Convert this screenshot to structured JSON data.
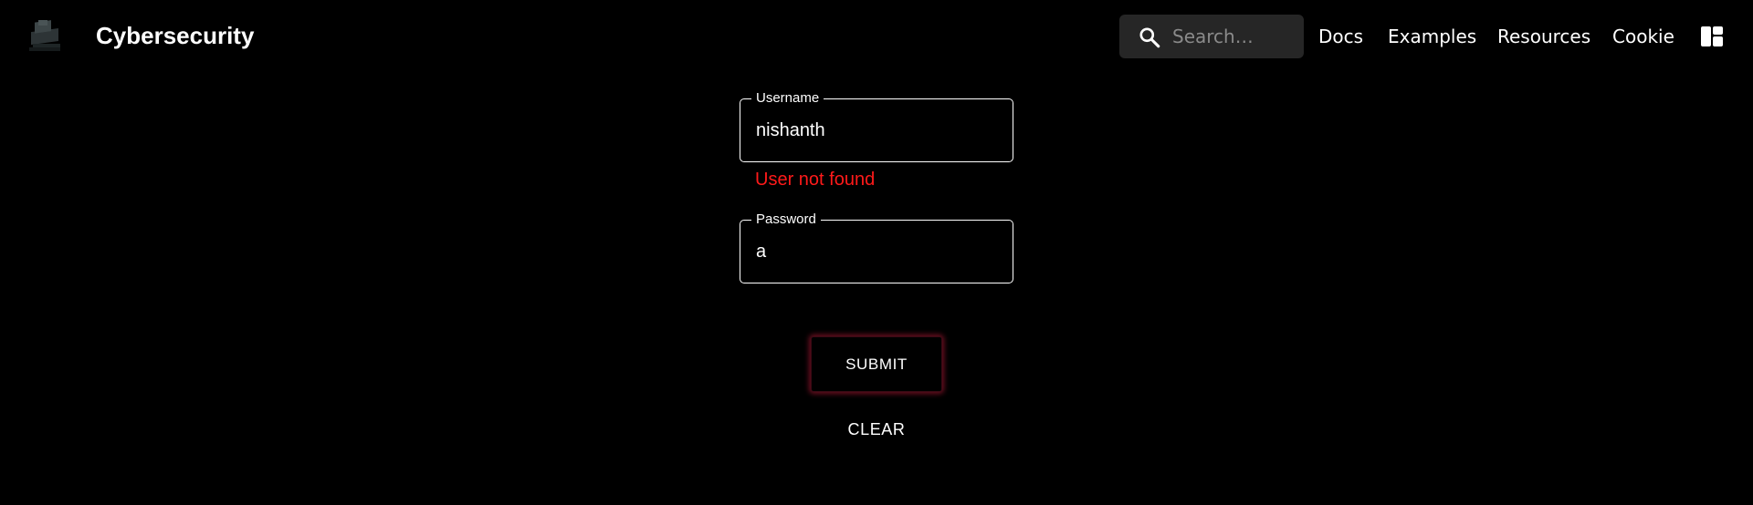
{
  "header": {
    "brand": "Cybersecurity",
    "search_placeholder": "Search…",
    "nav": [
      "Docs",
      "Examples",
      "Resources",
      "Cookie"
    ]
  },
  "form": {
    "username_label": "Username",
    "username_value": "nishanth",
    "username_error": "User not found",
    "password_label": "Password",
    "password_value": "a",
    "submit_label": "SUBMIT",
    "clear_label": "CLEAR"
  },
  "colors": {
    "background": "#000000",
    "error": "#ff1a1a",
    "search_bg": "#262626",
    "submit_glow": "#c81e3c"
  },
  "icons": {
    "logo": "computer-chip-logo-icon",
    "search": "search-icon",
    "layout": "layout-toggle-icon"
  }
}
